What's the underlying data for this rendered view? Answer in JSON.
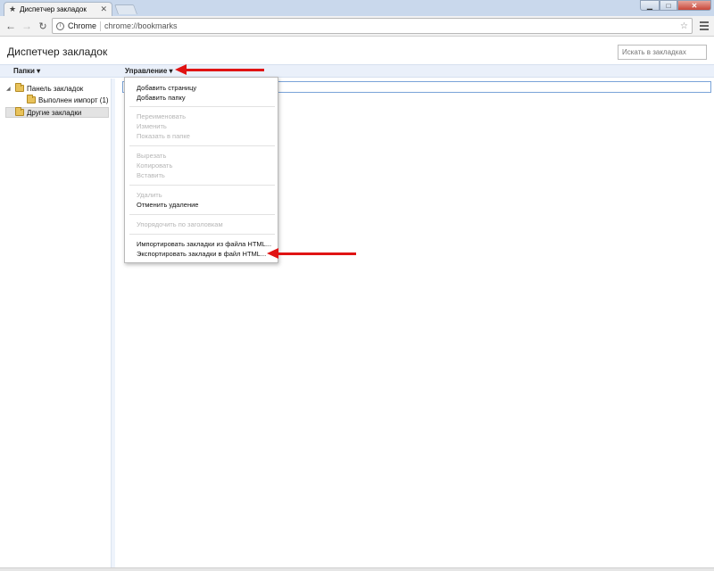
{
  "window": {
    "tab_title": "Диспетчер закладок",
    "tab_icon": "star-icon",
    "controls": {
      "minimize": "▁",
      "maximize": "□",
      "close": "✕"
    }
  },
  "toolbar": {
    "origin": "Chrome",
    "url": "chrome://bookmarks"
  },
  "page": {
    "title": "Диспетчер закладок",
    "search_placeholder": "Искать в закладках"
  },
  "header": {
    "folders_label": "Папки ▾",
    "organize_label": "Управление ▾"
  },
  "tree": {
    "items": [
      {
        "label": "Панель закладок"
      },
      {
        "label": "Выполнен импорт (1)"
      },
      {
        "label": "Другие закладки"
      }
    ]
  },
  "menu": {
    "items": [
      {
        "label": "Добавить страницу",
        "enabled": true
      },
      {
        "label": "Добавить папку",
        "enabled": true
      },
      {
        "label": "Переименовать",
        "enabled": false
      },
      {
        "label": "Изменить",
        "enabled": false
      },
      {
        "label": "Показать в папке",
        "enabled": false
      },
      {
        "label": "Вырезать",
        "enabled": false
      },
      {
        "label": "Копировать",
        "enabled": false
      },
      {
        "label": "Вставить",
        "enabled": false
      },
      {
        "label": "Удалить",
        "enabled": false
      },
      {
        "label": "Отменить удаление",
        "enabled": true
      },
      {
        "label": "Упорядочить по заголовкам",
        "enabled": false
      },
      {
        "label": "Импортировать закладки из файла HTML...",
        "enabled": true
      },
      {
        "label": "Экспортировать закладки в файл HTML...",
        "enabled": true
      }
    ]
  },
  "colors": {
    "annotation_arrow": "#e01313",
    "header_bar": "#eaf0fa",
    "selection_border": "#7aa3d8"
  }
}
